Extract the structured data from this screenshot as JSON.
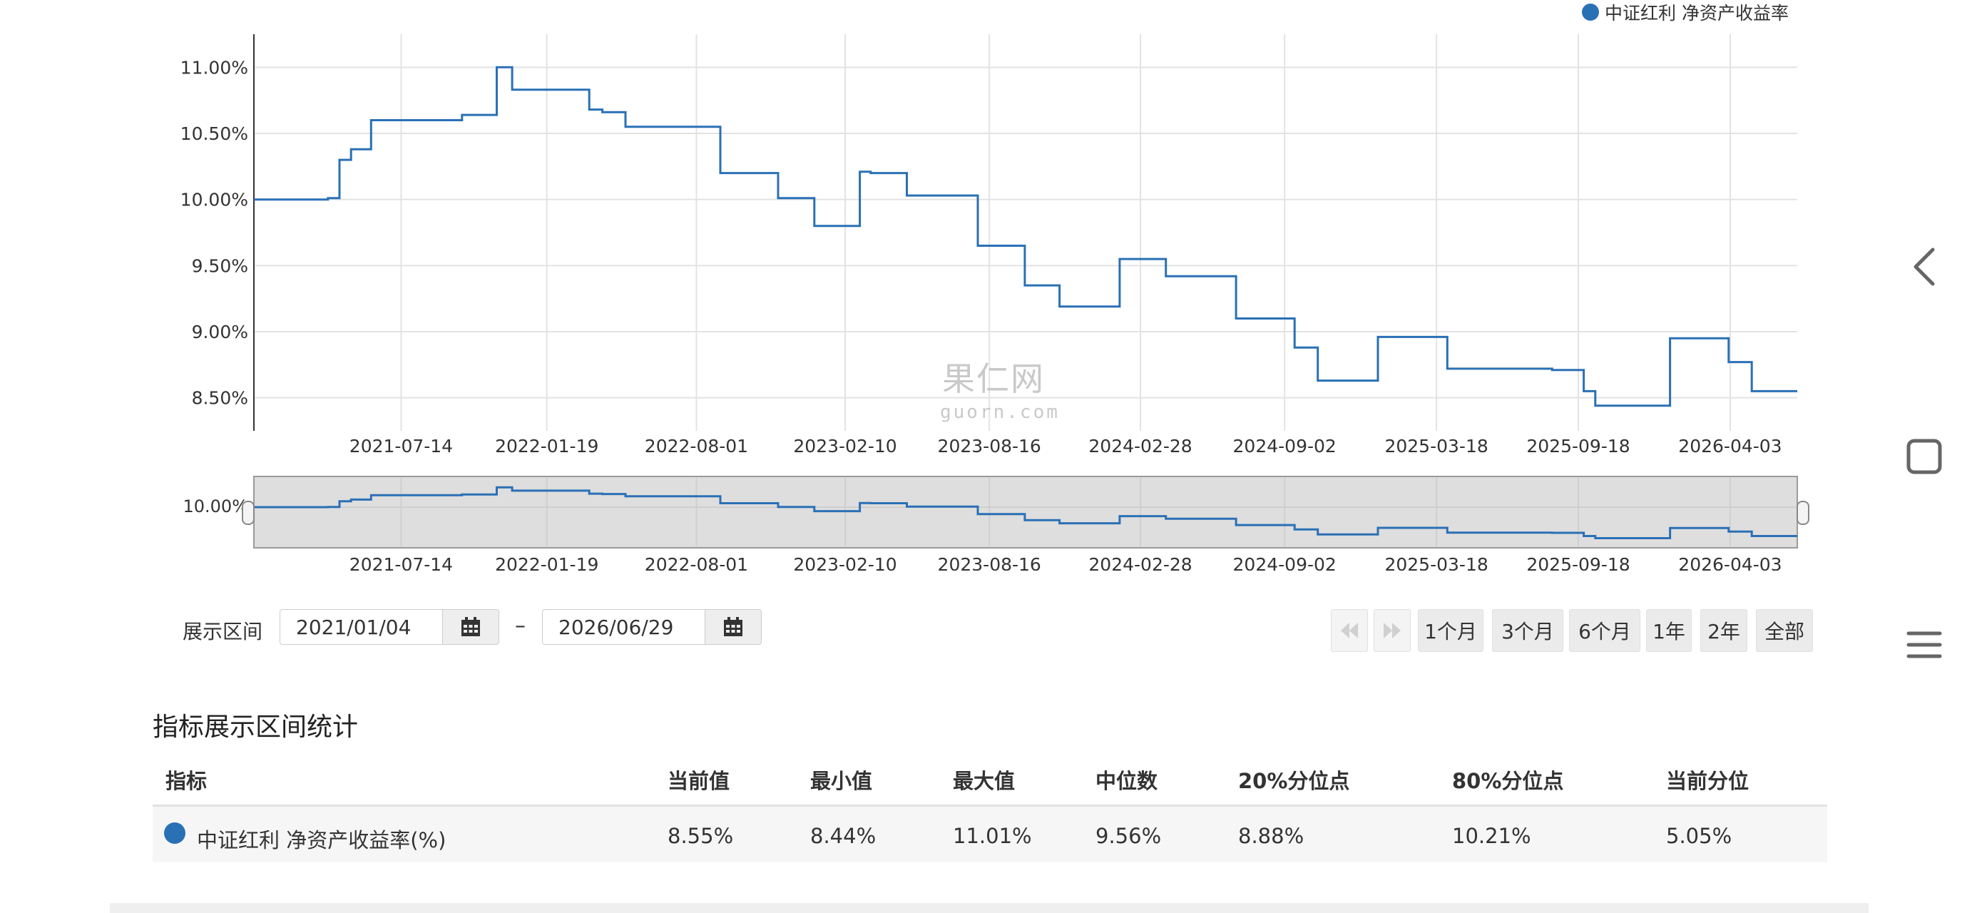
{
  "chart_data": {
    "type": "line",
    "legend": "中证红利 净资产收益率",
    "legend_color": "#2a70b5",
    "legend_position": "top-right",
    "series_color": "#2a70b5",
    "y_ticks": [
      "8.50%",
      "9.00%",
      "9.50%",
      "10.00%",
      "10.50%",
      "11.00%"
    ],
    "y_tick_values": [
      8.5,
      9.0,
      9.5,
      10.0,
      10.5,
      11.0
    ],
    "ylim": [
      8.25,
      11.25
    ],
    "x_ticks": [
      "2021-07-14",
      "2022-01-19",
      "2022-08-01",
      "2023-02-10",
      "2023-08-16",
      "2024-02-28",
      "2024-09-02",
      "2025-03-18",
      "2025-09-18",
      "2026-04-03"
    ],
    "navigator_y_tick": "10.00%",
    "grid": true,
    "x": [
      "2021-01-04",
      "2021-04-10",
      "2021-04-25",
      "2021-05-10",
      "2021-06-05",
      "2021-09-10",
      "2021-10-01",
      "2021-11-15",
      "2021-12-05",
      "2022-03-15",
      "2022-04-01",
      "2022-05-01",
      "2022-09-01",
      "2022-10-01",
      "2022-11-15",
      "2023-01-01",
      "2023-03-01",
      "2023-03-15",
      "2023-05-01",
      "2023-08-01",
      "2023-09-01",
      "2023-10-01",
      "2023-11-15",
      "2024-02-01",
      "2024-03-01",
      "2024-04-01",
      "2024-07-01",
      "2024-08-15",
      "2024-09-15",
      "2024-10-15",
      "2025-01-01",
      "2025-03-01",
      "2025-04-01",
      "2025-07-01",
      "2025-08-15",
      "2025-09-25",
      "2025-10-10",
      "2025-10-25",
      "2025-12-01",
      "2025-12-31",
      "2026-01-15",
      "2026-02-15",
      "2026-03-15",
      "2026-04-01",
      "2026-05-01",
      "2026-06-29"
    ],
    "y": [
      10.0,
      10.01,
      10.3,
      10.38,
      10.6,
      10.6,
      10.64,
      11.0,
      10.83,
      10.68,
      10.66,
      10.55,
      10.2,
      10.2,
      10.01,
      9.8,
      10.21,
      10.2,
      10.03,
      9.65,
      9.65,
      9.35,
      9.19,
      9.55,
      9.55,
      9.42,
      9.1,
      9.1,
      8.88,
      8.63,
      8.96,
      8.96,
      8.72,
      8.72,
      8.71,
      8.55,
      8.44,
      8.44,
      8.44,
      8.44,
      8.95,
      8.95,
      8.95,
      8.77,
      8.55,
      8.55
    ]
  },
  "watermark": {
    "cn": "果仁网",
    "en": "guorn.com"
  },
  "range": {
    "label": "展示区间",
    "start": "2021/01/04",
    "dash": "–",
    "end": "2026/06/29"
  },
  "buttons": [
    "1个月",
    "3个月",
    "6个月",
    "1年",
    "2年",
    "全部"
  ],
  "stats": {
    "title": "指标展示区间统计",
    "headers": [
      "指标",
      "当前值",
      "最小值",
      "最大值",
      "中位数",
      "20%分位点",
      "80%分位点",
      "当前分位"
    ],
    "row": {
      "name": "中证红利 净资产收益率(%)",
      "current": "8.55%",
      "min": "8.44%",
      "max": "11.01%",
      "median": "9.56%",
      "p20": "8.88%",
      "p80": "10.21%",
      "percentile": "5.05%"
    }
  }
}
